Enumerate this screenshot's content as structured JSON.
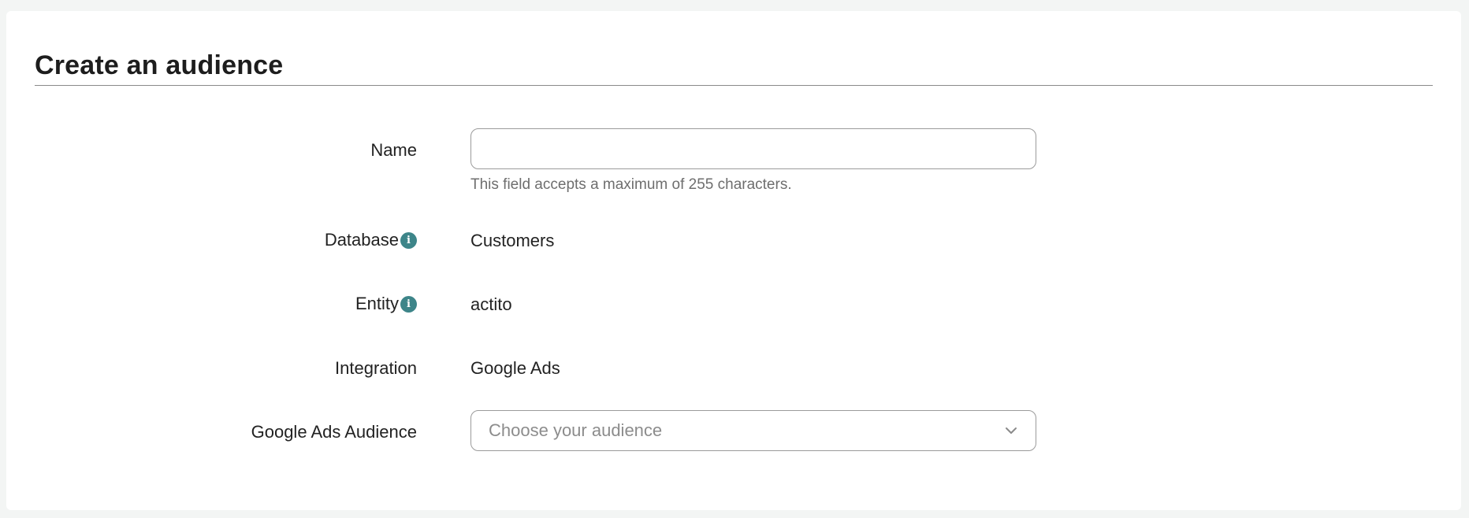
{
  "page": {
    "title": "Create an audience"
  },
  "form": {
    "name": {
      "label": "Name",
      "value": "",
      "placeholder": "",
      "helper": "This field accepts a maximum of 255 characters."
    },
    "database": {
      "label": "Database",
      "value": "Customers",
      "info_icon": "info-icon"
    },
    "entity": {
      "label": "Entity",
      "value": "actito",
      "info_icon": "info-icon"
    },
    "integration": {
      "label": "Integration",
      "value": "Google Ads"
    },
    "google_ads_audience": {
      "label": "Google Ads Audience",
      "placeholder": "Choose your audience",
      "selected": "",
      "icon": "chevron-down-icon"
    }
  },
  "colors": {
    "accent": "#3d8589",
    "background": "#f3f5f4",
    "card": "#ffffff",
    "border": "#9b9b9b",
    "helper_text": "#6e6e6e"
  }
}
